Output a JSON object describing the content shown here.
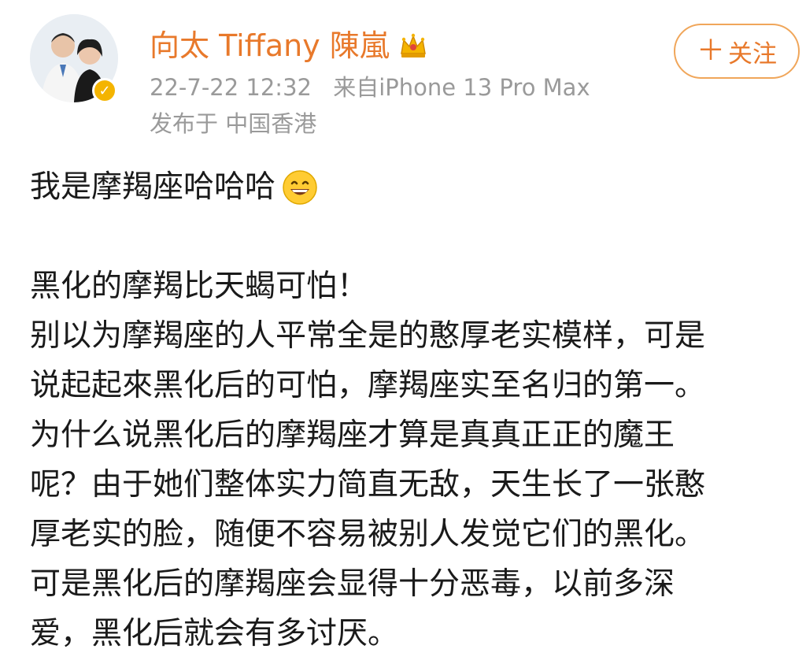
{
  "user": {
    "name": "向太 Tiffany 陳嵐",
    "post_time": "22-7-22 12:32",
    "source": "来自iPhone 13 Pro Max",
    "location": "发布于 中国香港"
  },
  "actions": {
    "follow_label": "关注"
  },
  "icons": {
    "crown": "crown-icon",
    "verified": "verified-badge-icon",
    "emoji": "grinning-face-icon"
  },
  "colors": {
    "accent": "#e8792b",
    "meta": "#9a9a9a",
    "text": "#1a1a1a"
  },
  "post": {
    "first_line": "我是摩羯座哈哈哈",
    "lines": [
      "黑化的摩羯比天蝎可怕！",
      "别以为摩羯座的人平常全是的憨厚老实模样，可是",
      "说起起來黑化后的可怕，摩羯座实至名归的第一。",
      "为什么说黑化后的摩羯座才算是真真正正的魔王",
      "呢？由于她们整体实力简直无敌，天生长了一张憨",
      "厚老实的脸，随便不容易被别人发觉它们的黑化。",
      "可是黑化后的摩羯座会显得十分恶毒，以前多深",
      "爱，黑化后就会有多讨厌。"
    ]
  }
}
